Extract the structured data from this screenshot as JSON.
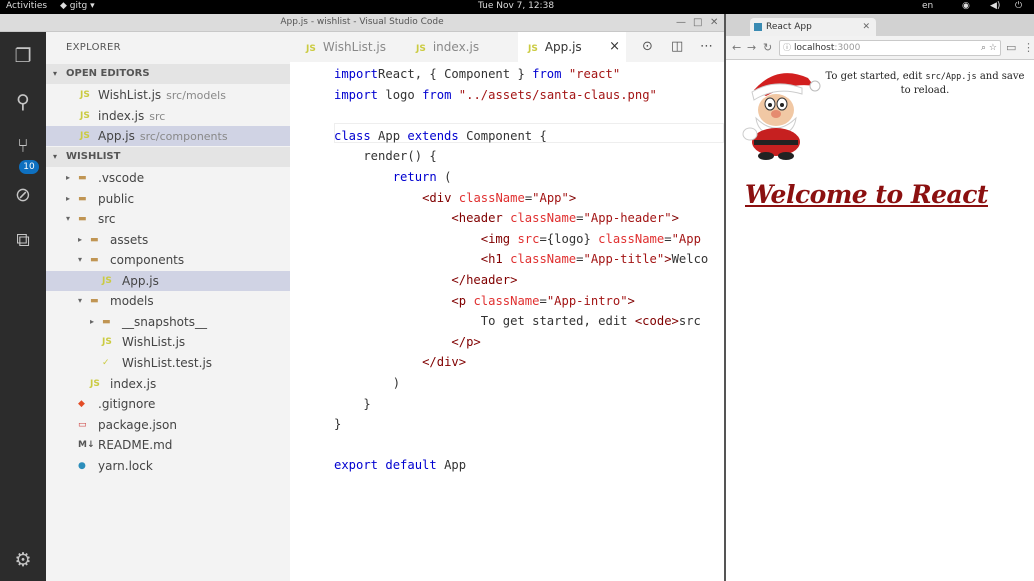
{
  "topbar": {
    "activities": "Activities",
    "app": "gitg",
    "clock": "Tue Nov  7, 12:38",
    "lang": "en"
  },
  "vscode": {
    "title": "App.js - wishlist - Visual Studio Code",
    "activity_badge": "10",
    "explorer_title": "EXPLORER",
    "open_editors_label": "OPEN EDITORS",
    "open_editors": [
      {
        "name": "WishList.js",
        "path": "src/models"
      },
      {
        "name": "index.js",
        "path": "src"
      },
      {
        "name": "App.js",
        "path": "src/components"
      }
    ],
    "project_label": "WISHLIST",
    "tree": [
      {
        "name": ".vscode",
        "depth": 0,
        "arrow": "▸",
        "icon": "folder"
      },
      {
        "name": "public",
        "depth": 0,
        "arrow": "▸",
        "icon": "folder"
      },
      {
        "name": "src",
        "depth": 0,
        "arrow": "▾",
        "icon": "folder"
      },
      {
        "name": "assets",
        "depth": 1,
        "arrow": "▸",
        "icon": "folder"
      },
      {
        "name": "components",
        "depth": 1,
        "arrow": "▾",
        "icon": "folder"
      },
      {
        "name": "App.js",
        "depth": 2,
        "arrow": "",
        "icon": "js",
        "selected": true
      },
      {
        "name": "models",
        "depth": 1,
        "arrow": "▾",
        "icon": "folder"
      },
      {
        "name": "__snapshots__",
        "depth": 2,
        "arrow": "▸",
        "icon": "folder"
      },
      {
        "name": "WishList.js",
        "depth": 2,
        "arrow": "",
        "icon": "js"
      },
      {
        "name": "WishList.test.js",
        "depth": 2,
        "arrow": "",
        "icon": "test"
      },
      {
        "name": "index.js",
        "depth": 1,
        "arrow": "",
        "icon": "js"
      },
      {
        "name": ".gitignore",
        "depth": 0,
        "arrow": "",
        "icon": "git"
      },
      {
        "name": "package.json",
        "depth": 0,
        "arrow": "",
        "icon": "npm"
      },
      {
        "name": "README.md",
        "depth": 0,
        "arrow": "",
        "icon": "md"
      },
      {
        "name": "yarn.lock",
        "depth": 0,
        "arrow": "",
        "icon": "yarn"
      }
    ],
    "tabs": [
      {
        "label": "WishList.js",
        "active": false
      },
      {
        "label": "index.js",
        "active": false
      },
      {
        "label": "App.js",
        "active": true
      }
    ],
    "tab_close": "×",
    "code_lines": [
      [
        [
          "kw",
          "import"
        ],
        [
          "",
          "React, { Component } "
        ],
        [
          "kw",
          "from"
        ],
        [
          "",
          " "
        ],
        [
          "str",
          "\"react\""
        ]
      ],
      [
        [
          "kw",
          "import"
        ],
        [
          "",
          " logo "
        ],
        [
          "kw",
          "from"
        ],
        [
          "",
          " "
        ],
        [
          "str",
          "\"../assets/santa-claus.png\""
        ]
      ],
      [],
      [
        [
          "kw",
          "class"
        ],
        [
          "",
          " App "
        ],
        [
          "kw",
          "extends"
        ],
        [
          "",
          " Component {"
        ]
      ],
      [
        [
          "",
          "    render() {"
        ]
      ],
      [
        [
          "",
          "        "
        ],
        [
          "kw",
          "return"
        ],
        [
          "",
          " ("
        ]
      ],
      [
        [
          "",
          "            "
        ],
        [
          "tag",
          "<div"
        ],
        [
          "",
          " "
        ],
        [
          "attr",
          "className"
        ],
        [
          "",
          "="
        ],
        [
          "str",
          "\"App\""
        ],
        [
          "tag",
          ">"
        ]
      ],
      [
        [
          "",
          "                "
        ],
        [
          "tag",
          "<header"
        ],
        [
          "",
          " "
        ],
        [
          "attr",
          "className"
        ],
        [
          "",
          "="
        ],
        [
          "str",
          "\"App-header\""
        ],
        [
          "tag",
          ">"
        ]
      ],
      [
        [
          "",
          "                    "
        ],
        [
          "tag",
          "<img"
        ],
        [
          "",
          " "
        ],
        [
          "attr",
          "src"
        ],
        [
          "",
          "={logo} "
        ],
        [
          "attr",
          "className"
        ],
        [
          "",
          "="
        ],
        [
          "str",
          "\"App"
        ]
      ],
      [
        [
          "",
          "                    "
        ],
        [
          "tag",
          "<h1"
        ],
        [
          "",
          " "
        ],
        [
          "attr",
          "className"
        ],
        [
          "",
          "="
        ],
        [
          "str",
          "\"App-title\""
        ],
        [
          "tag",
          ">"
        ],
        [
          "",
          "Welco"
        ]
      ],
      [
        [
          "",
          "                "
        ],
        [
          "tag",
          "</header>"
        ]
      ],
      [
        [
          "",
          "                "
        ],
        [
          "tag",
          "<p"
        ],
        [
          "",
          " "
        ],
        [
          "attr",
          "className"
        ],
        [
          "",
          "="
        ],
        [
          "str",
          "\"App-intro\""
        ],
        [
          "tag",
          ">"
        ]
      ],
      [
        [
          "",
          "                    To get started, edit "
        ],
        [
          "tag",
          "<code>"
        ],
        [
          "",
          "src"
        ]
      ],
      [
        [
          "",
          "                "
        ],
        [
          "tag",
          "</p>"
        ]
      ],
      [
        [
          "",
          "            "
        ],
        [
          "tag",
          "</div>"
        ]
      ],
      [
        [
          "",
          "        )"
        ]
      ],
      [
        [
          "",
          "    }"
        ]
      ],
      [
        [
          "",
          "}"
        ]
      ],
      [],
      [
        [
          "kw",
          "export"
        ],
        [
          "",
          " "
        ],
        [
          "kw",
          "default"
        ],
        [
          "",
          " App"
        ]
      ]
    ]
  },
  "chrome": {
    "tab_title": "React App",
    "url_host": "localhost",
    "url_port": ":3000",
    "intro_pre": "To get started, edit ",
    "intro_code": "src/App.js",
    "intro_post": " and save to reload.",
    "heading": "Welcome to React"
  },
  "colors": {
    "activity_bar": "#2c2c2c",
    "sidebar": "#f3f3f3",
    "badge": "#0e70c0",
    "heading": "#8b1010"
  }
}
